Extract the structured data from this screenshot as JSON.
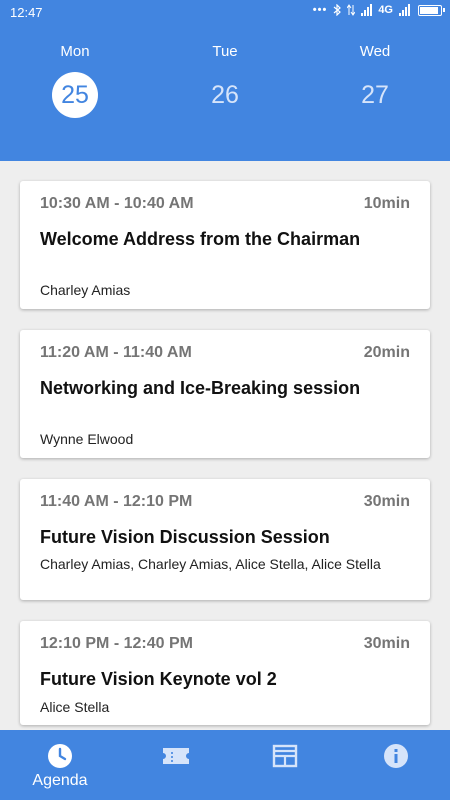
{
  "status_bar": {
    "time": "12:47",
    "network": "4G",
    "icons": [
      "notification-dots-icon",
      "bluetooth-icon",
      "data-arrows-icon",
      "signal-icon",
      "signal-icon",
      "battery-icon"
    ]
  },
  "days": [
    {
      "name": "Mon",
      "number": "25",
      "selected": true
    },
    {
      "name": "Tue",
      "number": "26",
      "selected": false
    },
    {
      "name": "Wed",
      "number": "27",
      "selected": false
    }
  ],
  "sessions": [
    {
      "time": "10:30 AM - 10:40 AM",
      "duration": "10min",
      "title": "Welcome Address from the Chairman",
      "speakers": "Charley Amias"
    },
    {
      "time": "11:20 AM - 11:40 AM",
      "duration": "20min",
      "title": "Networking and Ice-Breaking session",
      "speakers": "Wynne Elwood"
    },
    {
      "time": "11:40 AM - 12:10 PM",
      "duration": "30min",
      "title": "Future Vision Discussion Session",
      "speakers": "Charley Amias, Charley Amias, Alice Stella, Alice Stella"
    },
    {
      "time": "12:10 PM - 12:40 PM",
      "duration": "30min",
      "title": "Future Vision Keynote vol 2",
      "speakers": "Alice Stella"
    }
  ],
  "bottom_nav": [
    {
      "label": "Agenda",
      "icon": "clock-icon",
      "active": true
    },
    {
      "label": "",
      "icon": "ticket-icon",
      "active": false
    },
    {
      "label": "",
      "icon": "layout-icon",
      "active": false
    },
    {
      "label": "",
      "icon": "info-icon",
      "active": false
    }
  ],
  "colors": {
    "primary": "#4285e0",
    "background": "#eeeeee",
    "card": "#ffffff",
    "muted_text": "#757575"
  }
}
